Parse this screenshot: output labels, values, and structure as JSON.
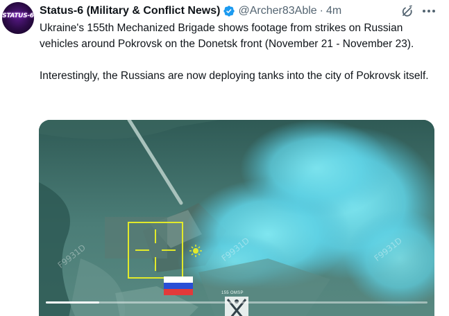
{
  "author": {
    "avatar_label": "STATUS-6",
    "display_name": "Status-6 (Military & Conflict News)",
    "handle": "@Archer83Able",
    "separator": "·",
    "time": "4m",
    "verified_color": "#1d9bf0"
  },
  "tweet": {
    "paragraph_1": "Ukraine's 155th Mechanized Brigade shows footage from strikes on Russian vehicles around Pokrovsk on the Donetsk front (November 21 - November 23).",
    "paragraph_2": "Interestingly, the Russians are now deploying tanks into the city of Pokrovsk itself."
  },
  "media": {
    "watermark_left": "F9931D",
    "watermark_center": "F9931D",
    "watermark_right": "F9931D",
    "unit_label": "155 OMSP",
    "progress": 0.14
  },
  "actions": {
    "grok_icon": "grok-icon",
    "more_icon": "more-options-icon"
  }
}
